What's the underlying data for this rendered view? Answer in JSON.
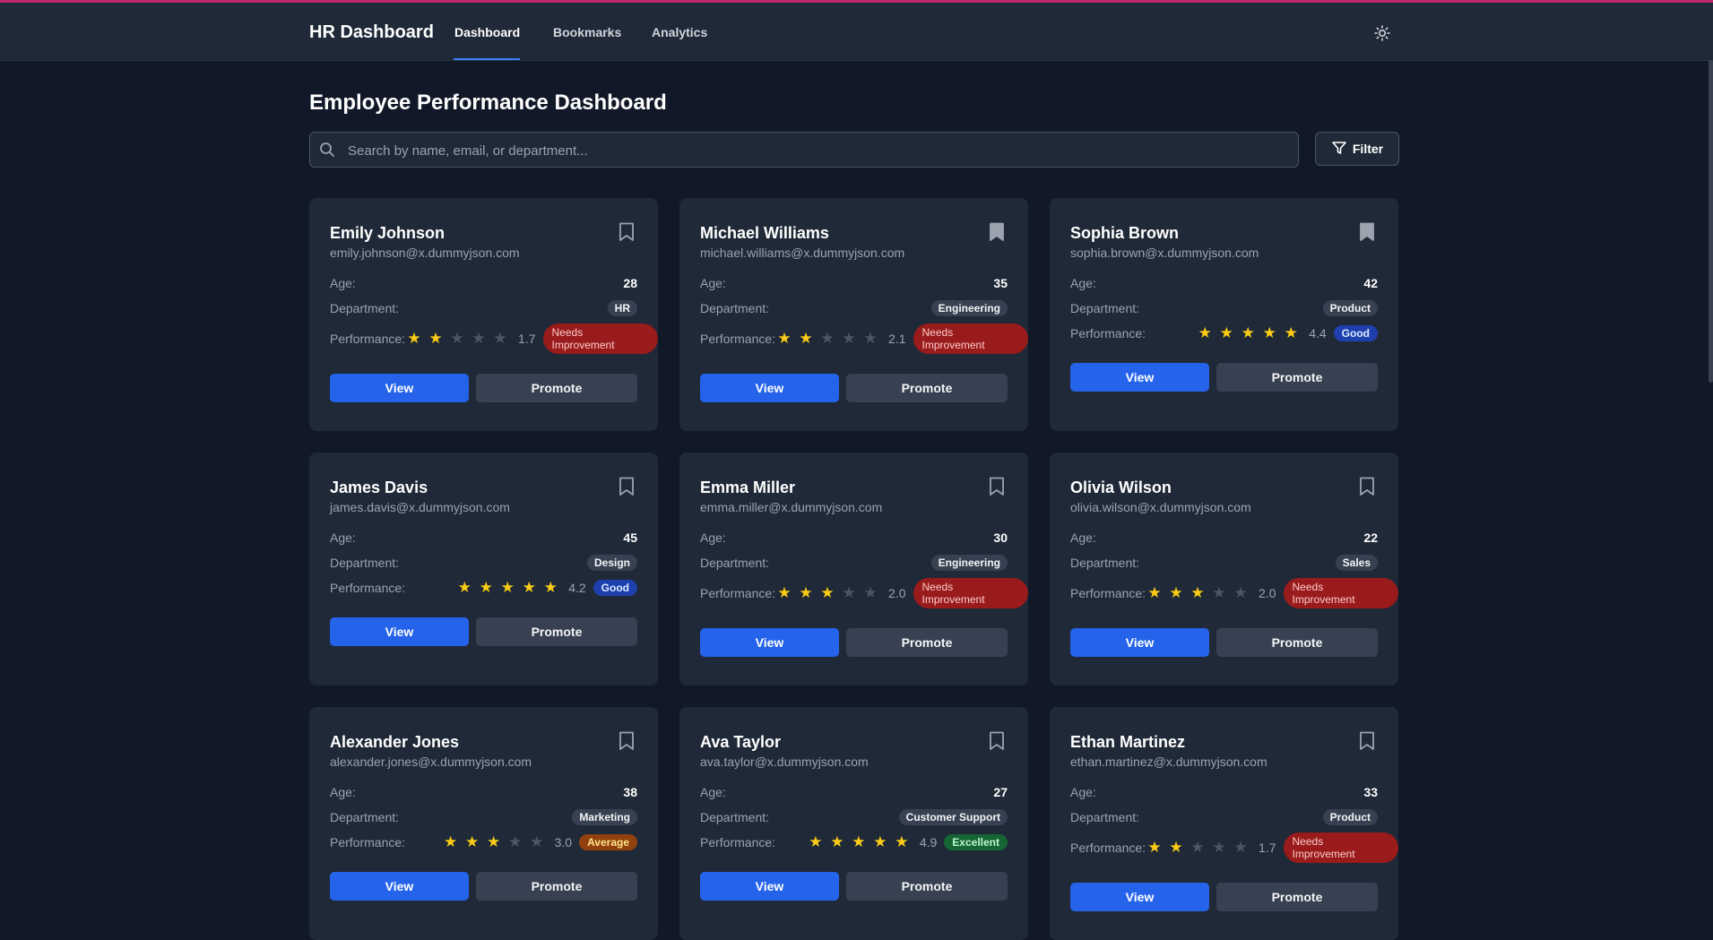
{
  "nav": {
    "brand": "HR Dashboard",
    "links": [
      "Dashboard",
      "Bookmarks",
      "Analytics"
    ],
    "active": "Dashboard",
    "theme_icon": "sun-icon"
  },
  "page": {
    "title": "Employee Performance Dashboard",
    "search_placeholder": "Search by name, email, or department...",
    "search_value": "",
    "filter_label": "Filter"
  },
  "labels": {
    "age": "Age:",
    "department": "Department:",
    "performance": "Performance:",
    "view": "View",
    "promote": "Promote"
  },
  "colors": {
    "accent": "#2563eb",
    "star": "#facc15",
    "needs_improvement": "#991b1b",
    "good": "#1e40af",
    "average": "#92400e",
    "excellent": "#166534"
  },
  "employees": [
    {
      "name": "Emily Johnson",
      "email": "emily.johnson@x.dummyjson.com",
      "age": "28",
      "department": "HR",
      "stars": 2,
      "rating": "1.7",
      "status": "Needs Improvement",
      "status_type": "needs",
      "bookmarked": false
    },
    {
      "name": "Michael Williams",
      "email": "michael.williams@x.dummyjson.com",
      "age": "35",
      "department": "Engineering",
      "stars": 2,
      "rating": "2.1",
      "status": "Needs Improvement",
      "status_type": "needs",
      "bookmarked": true
    },
    {
      "name": "Sophia Brown",
      "email": "sophia.brown@x.dummyjson.com",
      "age": "42",
      "department": "Product",
      "stars": 5,
      "rating": "4.4",
      "status": "Good",
      "status_type": "good",
      "bookmarked": true
    },
    {
      "name": "James Davis",
      "email": "james.davis@x.dummyjson.com",
      "age": "45",
      "department": "Design",
      "stars": 5,
      "rating": "4.2",
      "status": "Good",
      "status_type": "good",
      "bookmarked": false
    },
    {
      "name": "Emma Miller",
      "email": "emma.miller@x.dummyjson.com",
      "age": "30",
      "department": "Engineering",
      "stars": 3,
      "rating": "2.0",
      "status": "Needs Improvement",
      "status_type": "needs",
      "bookmarked": false
    },
    {
      "name": "Olivia Wilson",
      "email": "olivia.wilson@x.dummyjson.com",
      "age": "22",
      "department": "Sales",
      "stars": 3,
      "rating": "2.0",
      "status": "Needs Improvement",
      "status_type": "needs",
      "bookmarked": false
    },
    {
      "name": "Alexander Jones",
      "email": "alexander.jones@x.dummyjson.com",
      "age": "38",
      "department": "Marketing",
      "stars": 3,
      "rating": "3.0",
      "status": "Average",
      "status_type": "average",
      "bookmarked": false
    },
    {
      "name": "Ava Taylor",
      "email": "ava.taylor@x.dummyjson.com",
      "age": "27",
      "department": "Customer Support",
      "stars": 5,
      "rating": "4.9",
      "status": "Excellent",
      "status_type": "excellent",
      "bookmarked": false
    },
    {
      "name": "Ethan Martinez",
      "email": "ethan.martinez@x.dummyjson.com",
      "age": "33",
      "department": "Product",
      "stars": 2,
      "rating": "1.7",
      "status": "Needs Improvement",
      "status_type": "needs",
      "bookmarked": false
    }
  ]
}
